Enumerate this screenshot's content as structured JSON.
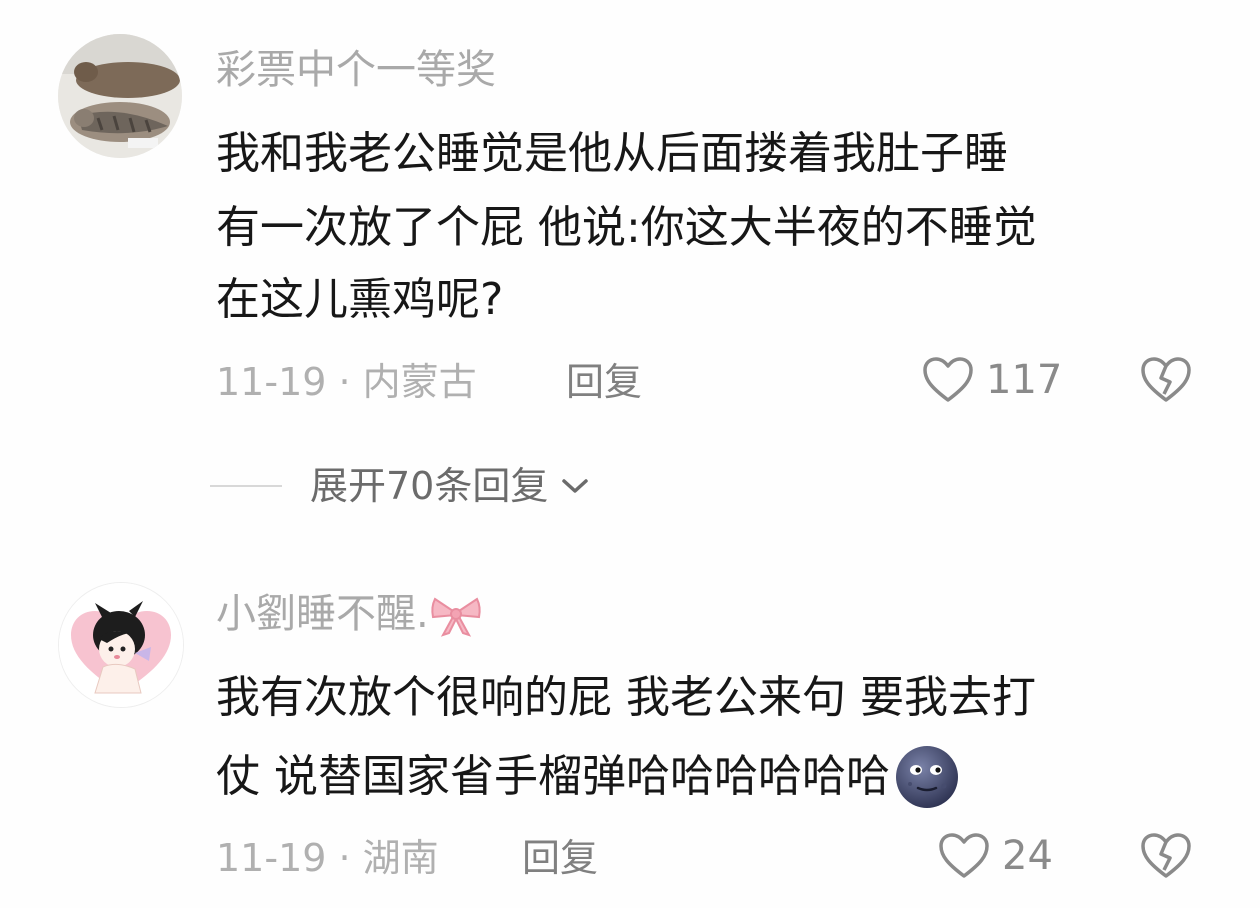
{
  "comments": [
    {
      "username": "彩票中个一等奖",
      "avatar_icon": "cat-photo-avatar",
      "content_lines": [
        "我和我老公睡觉是他从后面搂着我肚子睡",
        "有一次放了个屁 他说:你这大半夜的不睡觉",
        "在这儿熏鸡呢?"
      ],
      "meta": "11-19 · 内蒙古",
      "reply_label": "回复",
      "like_count": "117"
    },
    {
      "username": "小劉睡不醒.",
      "username_emoji": "bow-emoji",
      "avatar_icon": "cartoon-girl-avatar",
      "content_lines": [
        "我有次放个很响的屁 我老公来句 要我去打",
        "仗 说替国家省手榴弹哈哈哈哈哈哈"
      ],
      "content_emoji": "new-moon-face-emoji",
      "meta": "11-19 · 湖南",
      "reply_label": "回复",
      "like_count": "24"
    }
  ],
  "expand_replies": {
    "label": "展开70条回复",
    "icon": "chevron-down-icon"
  },
  "colors": {
    "background": "#fefefe",
    "username": "#a9a9a9",
    "content": "#171717",
    "meta": "#b0b0b0",
    "icon": "#8a8a8a"
  }
}
